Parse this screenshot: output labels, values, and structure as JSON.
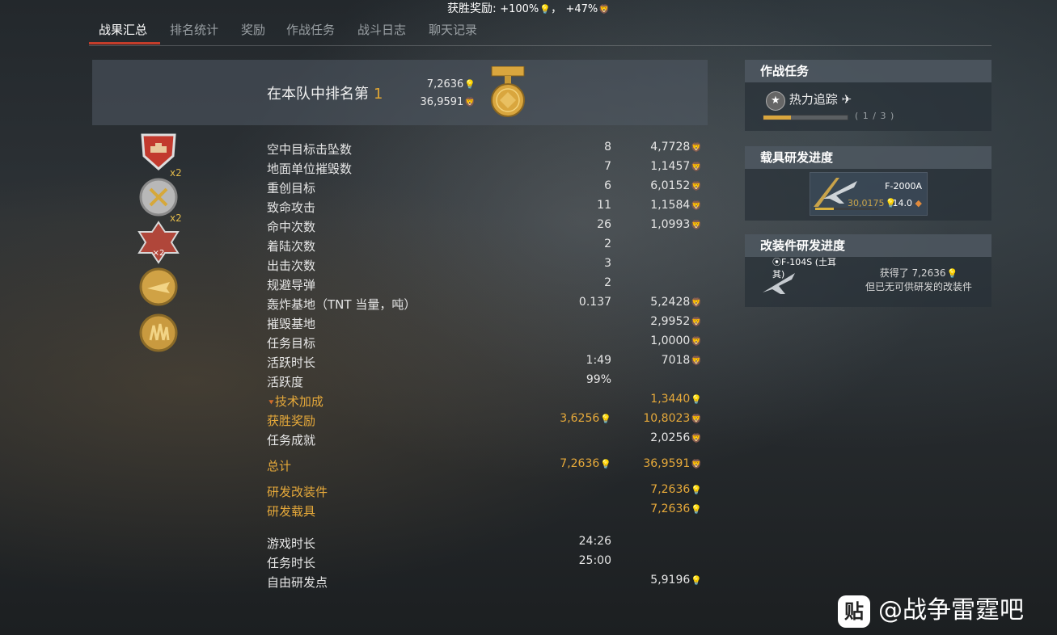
{
  "top_banner": {
    "label": "获胜奖励:",
    "rp_bonus": "+100%",
    "sep": "，",
    "sl_bonus": "+47%"
  },
  "tabs": [
    "战果汇总",
    "排名统计",
    "奖励",
    "作战任务",
    "战斗日志",
    "聊天记录"
  ],
  "active_tab": 0,
  "rank": {
    "label": "在本队中排名第",
    "position": "1",
    "rp": "7,2636",
    "sl": "36,9591"
  },
  "awards": [
    {
      "icon": "tank-destroyer-shield-icon",
      "multiplier": ""
    },
    {
      "icon": "crossed-swords-medal-icon",
      "multiplier": "x2"
    },
    {
      "icon": "artillery-cross-medal-icon",
      "multiplier": "x2"
    },
    {
      "icon": "gold-aircraft-medal-icon",
      "multiplier": ""
    },
    {
      "icon": "gold-wings-medal-icon",
      "multiplier": ""
    }
  ],
  "stats": [
    {
      "label": "空中目标击坠数",
      "count": "8",
      "sl": "4,7728"
    },
    {
      "label": "地面单位摧毁数",
      "count": "7",
      "sl": "1,1457"
    },
    {
      "label": "重创目标",
      "count": "6",
      "sl": "6,0152"
    },
    {
      "label": "致命攻击",
      "count": "11",
      "sl": "1,1584"
    },
    {
      "label": "命中次数",
      "count": "26",
      "sl": "1,0993"
    },
    {
      "label": "着陆次数",
      "count": "2",
      "sl": ""
    },
    {
      "label": "出击次数",
      "count": "3",
      "sl": ""
    },
    {
      "label": "规避导弹",
      "count": "2",
      "sl": ""
    },
    {
      "label": "轰炸基地（TNT 当量，吨）",
      "count": "0.137",
      "sl": "5,2428"
    },
    {
      "label": "摧毁基地",
      "count": "",
      "sl": "2,9952"
    },
    {
      "label": "任务目标",
      "count": "",
      "sl": "1,0000"
    },
    {
      "label": "活跃时长",
      "count": "1:49",
      "sl": "7018"
    },
    {
      "label": "活跃度",
      "count": "99%",
      "sl": ""
    }
  ],
  "tech_bonus": {
    "label": "技术加成",
    "rp": "1,3440"
  },
  "win_reward": {
    "label": "获胜奖励",
    "rp": "3,6256",
    "sl": "10,8023"
  },
  "mission_achievement": {
    "label": "任务成就",
    "sl": "2,0256"
  },
  "total": {
    "label": "总计",
    "rp": "7,2636",
    "sl": "36,9591"
  },
  "research_mods": {
    "label": "研发改装件",
    "rp": "7,2636"
  },
  "research_vehicle": {
    "label": "研发载具",
    "rp": "7,2636"
  },
  "game_time": {
    "label": "游戏时长",
    "value": "24:26"
  },
  "mission_time": {
    "label": "任务时长",
    "value": "25:00"
  },
  "free_rp": {
    "label": "自由研发点",
    "value": "5,9196"
  },
  "side_mission": {
    "title": "作战任务",
    "name": "热力追踪",
    "progress_text": "( 1 / 3 )",
    "progress": 0.333
  },
  "side_vehicle": {
    "title": "载具研发进度",
    "name": "F-2000A",
    "rp": "30,0175",
    "br": "14.0",
    "progress": 0.3
  },
  "side_mods": {
    "title": "改装件研发进度",
    "vehicle": "F-104S (土耳其)",
    "earned": "获得了 7,2636",
    "note": "但已无可供研发的改装件"
  },
  "watermark": {
    "logo": "贴",
    "text": "@战争雷霆吧"
  },
  "colors": {
    "accent_red": "#c43d2b",
    "gold": "#e6a93a",
    "rp_blue": "#8fbcd6"
  }
}
